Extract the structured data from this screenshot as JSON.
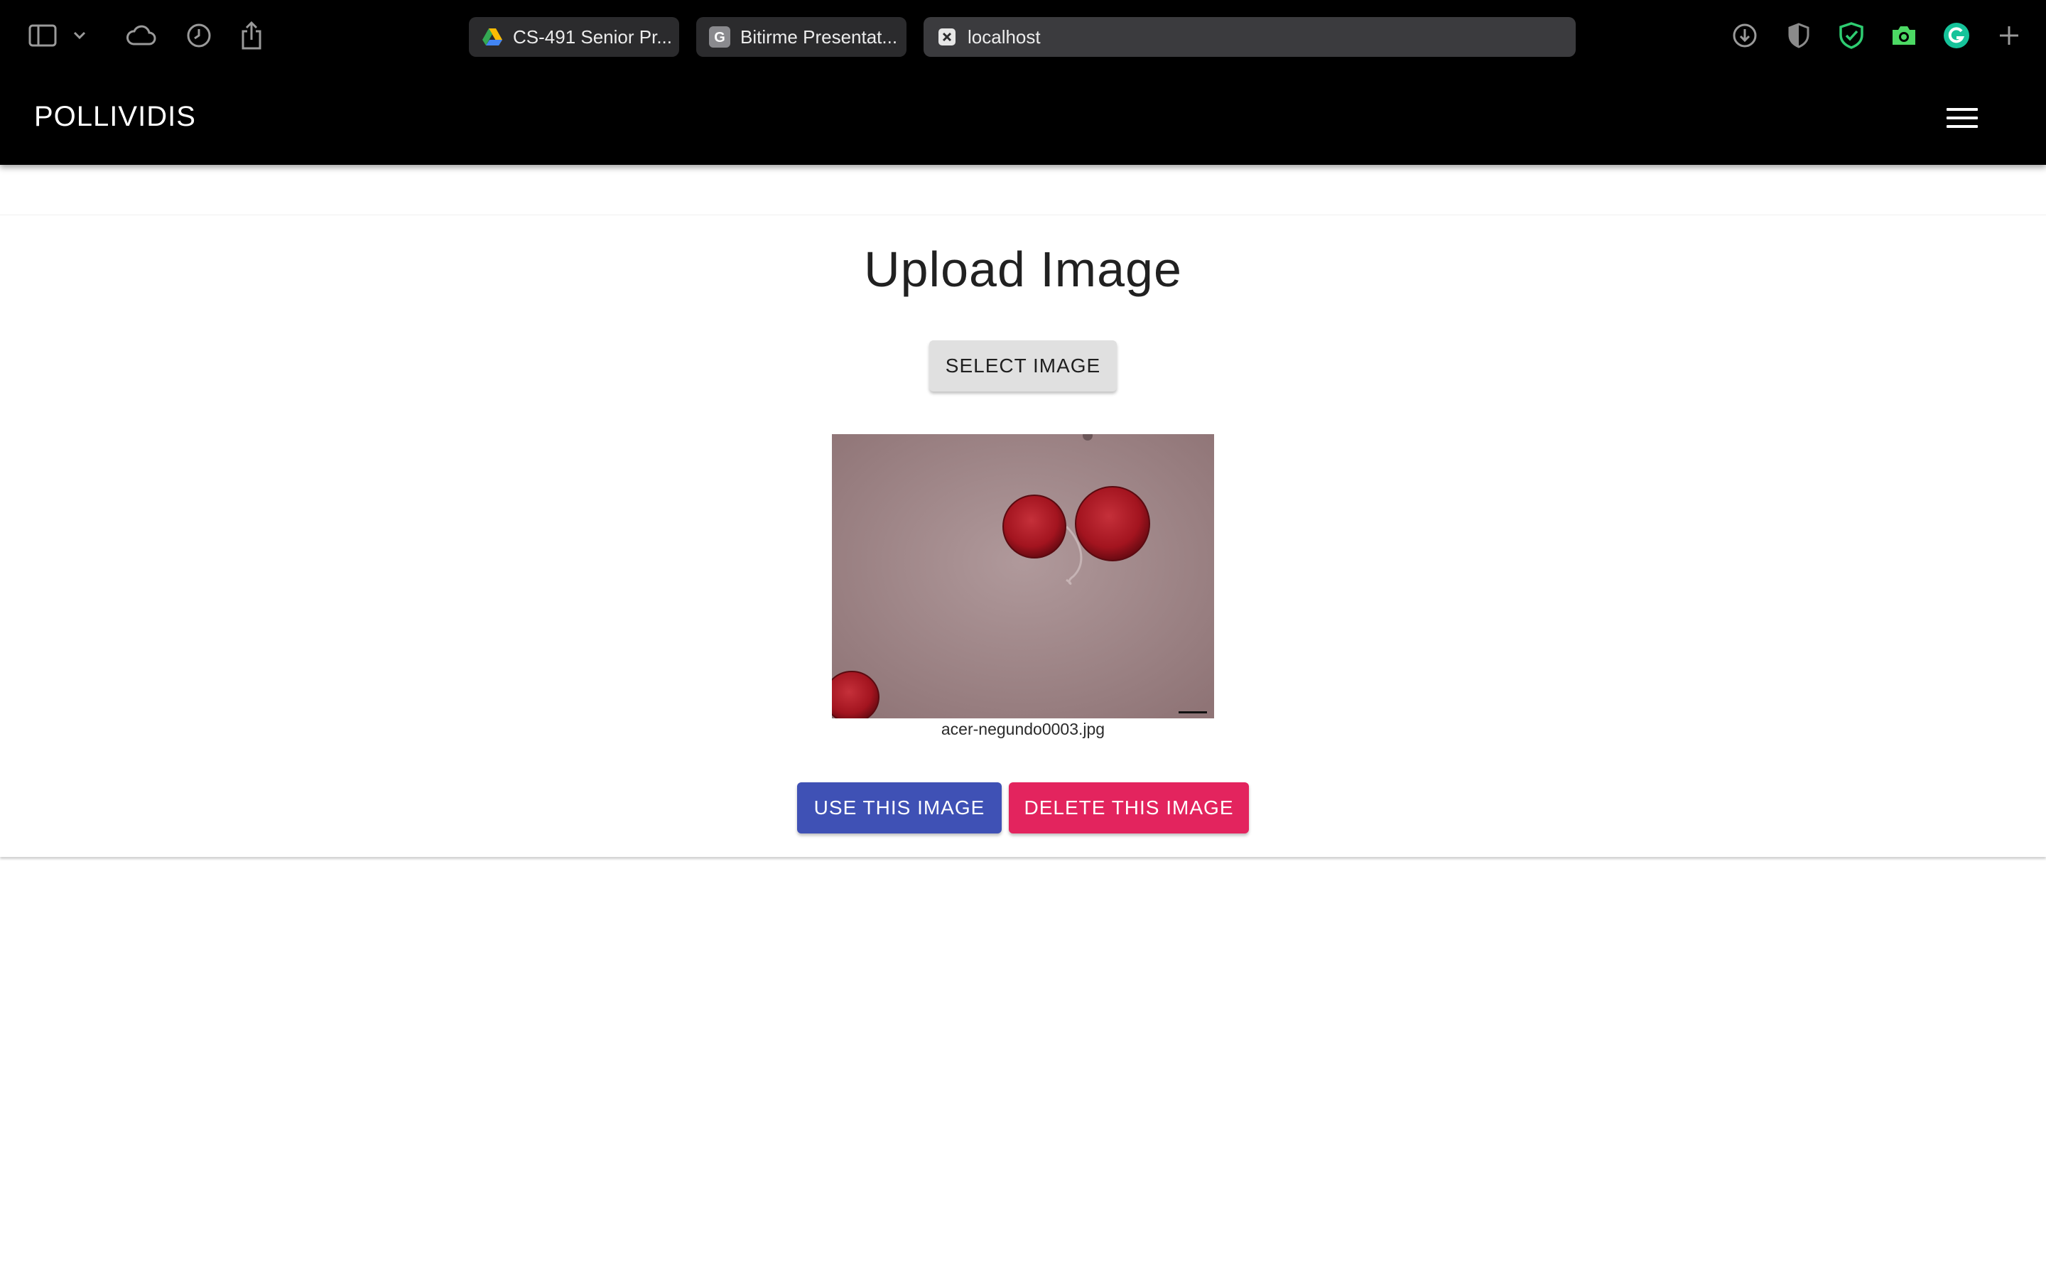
{
  "browser": {
    "tabs": [
      {
        "label": "CS-491 Senior Pr...",
        "icon": "google-drive-icon"
      },
      {
        "label": "Bitirme Presentat...",
        "icon": "g-letter-icon"
      },
      {
        "label": "localhost",
        "icon": "close-box-icon"
      }
    ]
  },
  "app": {
    "brand": "POLLIVIDIS",
    "menu_icon": "hamburger-menu-icon"
  },
  "upload": {
    "title": "Upload Image",
    "select_label": "SELECT IMAGE",
    "filename": "acer-negundo0003.jpg",
    "use_label": "USE THIS IMAGE",
    "delete_label": "DELETE THIS IMAGE",
    "image_alt": "acer-negundo0003.jpg"
  },
  "colors": {
    "app_bar": "#000000",
    "primary": "#3f51b5",
    "danger": "#e3245e",
    "select_button": "#e0e0e0"
  }
}
